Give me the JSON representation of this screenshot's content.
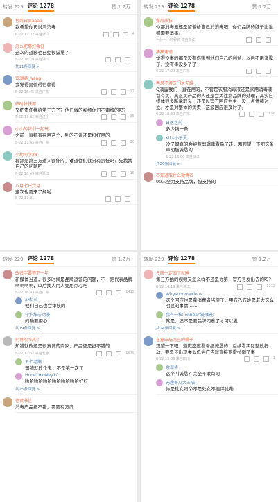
{
  "panels": [
    {
      "tabs": [
        "转发 229",
        "评论 1278",
        "赞 1.2万"
      ],
      "comments": [
        {
          "name": "苞芮自贡aaaa",
          "text": "我希望你再说清消毒",
          "meta": "6-22 17:32 来自浙江",
          "likes": "4"
        },
        {
          "name": "怎么肥事好会低",
          "text": "这次的道歉也已经很诚恳了",
          "meta": "6-22 16:28 来自浙江",
          "likes": "",
          "more": "共11条回复 >"
        },
        {
          "name": "钞潮满_wang",
          "text": "我觉得是值得信赖得",
          "meta": "6-22 16:45 来自广东",
          "likes": "22"
        },
        {
          "name": "临时帐侠部",
          "text": "又把责任推给第三方了？他们做的视频你们不审核的吗？",
          "meta": "6-22 17:02 来自辽宁",
          "likes": "35"
        },
        {
          "name": "小小的我们一起玩",
          "text": "之前一直都有在用这个，别的不说还是挺好用的",
          "meta": "6-22 17:45 来自广东",
          "likes": "20"
        },
        {
          "name": "小胡同学28",
          "text": "视频是第三方达人创作的，难道你们就没有责任吗？先找找自己的问题吧",
          "meta": "6-22 16:49 来自浙江",
          "likes": "15"
        },
        {
          "name": "八月七日六月",
          "text": "这次也要来了解啦",
          "meta": "6-22 17:01",
          "likes": ""
        }
      ]
    },
    {
      "tabs": [
        "转发 229",
        "评论 1278",
        "赞 1.2万"
      ],
      "comments": [
        {
          "name": "撑层底狂",
          "text": "你那消毒液还是留着给自己消消毒吧，你们品牌的脑子比谁都需要消毒。",
          "meta": "一分一小时秒钟 来自浙江",
          "likes": ""
        },
        {
          "name": "猫猫速递",
          "text": "觉得没事的都是没有伤害到他们自己的利益，以后不用滴露了，没有毒没多了了",
          "meta": "6-22 17:20 来自广东",
          "likes": ""
        },
        {
          "name": "春风不渡玉门关无绿",
          "text": "Q滴露我们一直在用的，不管是衣服消毒液还是家用消毒液都有买，真正买产品的人还是会关注到品牌的处理，其实自媒体很多断章取义，还是以官方回应为主，没一点情绪对立。才是对整体的负责，这波回应很及时了。",
          "meta": "6-22 16:30 来自广东",
          "likes": "898",
          "replies": [
            {
              "name": "日落之前",
              "text": "多少钱一条"
            },
            {
              "name": "Kiki-小乐夏",
              "text": "没了解真的会被惹剪辑幸看鼻子走，两观望一下吧这条声明挺诚恳的",
              "meta": "6-22 16:00 来自浙江"
            }
          ],
          "more": "共20条回复 >"
        },
        {
          "name": "不知道取什么微博名",
          "text": "90人全力支持品牌，挺支持的",
          "meta": "",
          "likes": ""
        }
      ]
    },
    {
      "tabs": [
        "转发 229",
        "评论 1278",
        "赞 1.2万"
      ],
      "comments": [
        {
          "name": "改名字要等下一年",
          "text": "新媒体当道，很多时候是品牌运营的问题，不一定代表品牌啊啊啊啊，以后找人用人要用点心吧",
          "meta": "6-22 16:43 来自广东",
          "likes": "1415",
          "replies": [
            {
              "name": "xMaei",
              "text": "他们自己也会审核的"
            },
            {
              "name": "守护甜心动漫",
              "text": "的确要用心"
            }
          ],
          "more": "共19条回复 >"
        },
        {
          "name": "别再吹冷风了",
          "text": "知错就改还是很真诚的商家，产品还是挺不错的",
          "meta": "6-22 12:57 来自北京",
          "likes": "1679",
          "replies": [
            {
              "name": "五仁老鹅",
              "text": "知错就改个鬼，不是第一次了"
            },
            {
              "name": "HoneYmoNey10",
              "text": "哈哈哈哈哈哈哈哈哈哈哈哈好好"
            }
          ],
          "more": "共25条回复 >"
        },
        {
          "name": "德君书信",
          "text": "消毒产品挺不错，需要有方向",
          "meta": "",
          "likes": ""
        }
      ]
    },
    {
      "tabs": [
        "转发 229",
        "评论 1278",
        "赞 1.2万"
      ],
      "comments": [
        {
          "name": "今晚一定困了就睡",
          "text": "第三方拍的视频又怎么样不还是你第一官方号发出去的吗？",
          "meta": "6-22 14:19 来自浙江",
          "likes": "1212",
          "replies": [
            {
              "name": "Whysooooserious",
              "text": "这个回应也是拿消费者当傻子，甲方乙方谁是老大这么明显的事情……"
            },
            {
              "name": "我有一粒lionheart能咖能",
              "text": "就是，还不是要品牌同意了才可以发"
            }
          ],
          "more": "共24条回复 >"
        },
        {
          "name": "在童田玩泥巴的橘子",
          "text": "观望一下吧，道歉态度看着挺诚恳的，后续看实际整改行动，要是还出现类似低俗广告就直接避雷拉倒了事",
          "meta": "6-22 13:06 来自四川",
          "likes": "1",
          "replies": [
            {
              "name": "余翠华",
              "text": "这个叫诚恳？完全不敢苟同"
            },
            {
              "name": "无趣冬瓜大王喵",
              "text": "你是社女吗😮不是处女不能评论嘞"
            }
          ]
        }
      ]
    }
  ],
  "colors": {
    "accent": "#ff8200",
    "name": "#eb7350",
    "link": "#507daf"
  },
  "icons": [
    "avatar",
    "share-icon",
    "comment-icon",
    "like-icon"
  ]
}
